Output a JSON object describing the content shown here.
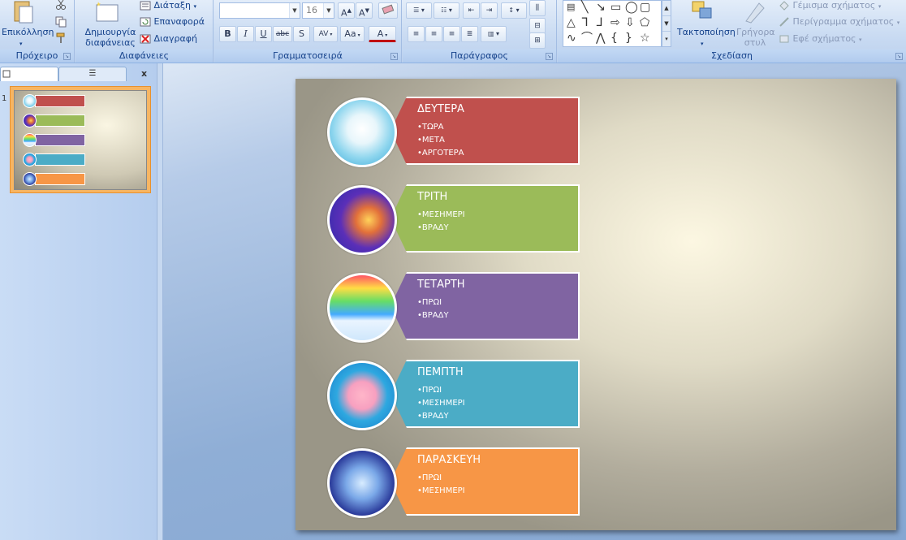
{
  "ribbon": {
    "clipboard": {
      "paste_label": "Επικόλληση",
      "group_label": "Πρόχειρο"
    },
    "slides": {
      "new_slide_label": "Δημιουργία διαφάνειας",
      "layout_label": "Διάταξη",
      "reset_label": "Επαναφορά",
      "delete_label": "Διαγραφή",
      "group_label": "Διαφάνειες"
    },
    "font": {
      "font_size_value": "16",
      "bold": "B",
      "italic": "I",
      "underline": "U",
      "strike": "abc",
      "shadow": "S",
      "spacing": "AV",
      "case": "Aa",
      "color": "A",
      "group_label": "Γραμματοσειρά"
    },
    "paragraph": {
      "group_label": "Παράγραφος"
    },
    "drawing": {
      "arrange_label": "Τακτοποίηση",
      "quick_styles_label": "Γρήγορα στυλ",
      "shape_fill_label": "Γέμισμα σχήματος",
      "shape_outline_label": "Περίγραμμα σχήματος",
      "shape_effects_label": "Εφέ σχήματος",
      "group_label": "Σχεδίαση"
    }
  },
  "panel": {
    "close_label": "x",
    "slide_number": "1"
  },
  "slide": {
    "items": [
      {
        "title": "ΔΕΥΤΕΡΑ",
        "bullets": [
          "ΤΩΡΑ",
          "ΜΕΤΑ",
          "ΑΡΓΟΤΕΡΑ"
        ],
        "color": "#c0504d"
      },
      {
        "title": "ΤΡΙΤΗ",
        "bullets": [
          "ΜΕΣΗΜΕΡΙ",
          "ΒΡΑΔΥ"
        ],
        "color": "#9bbb59"
      },
      {
        "title": "ΤΕΤΑΡΤΗ",
        "bullets": [
          "ΠΡΩΙ",
          "ΒΡΑΔΥ"
        ],
        "color": "#8064a2"
      },
      {
        "title": "ΠΕΜΠΤΗ",
        "bullets": [
          "ΠΡΩΙ",
          "ΜΕΣΗΜΕΡΙ",
          "ΒΡΑΔΥ"
        ],
        "color": "#4bacc6"
      },
      {
        "title": "ΠΑΡΑΣΚΕΥΗ",
        "bullets": [
          "ΠΡΩΙ",
          "ΜΕΣΗΜΕΡΙ"
        ],
        "color": "#f79646"
      }
    ]
  },
  "icons": {
    "paste": "paste-icon",
    "cut": "scissors-icon",
    "copy": "copy-icon",
    "format_painter": "brush-icon"
  }
}
